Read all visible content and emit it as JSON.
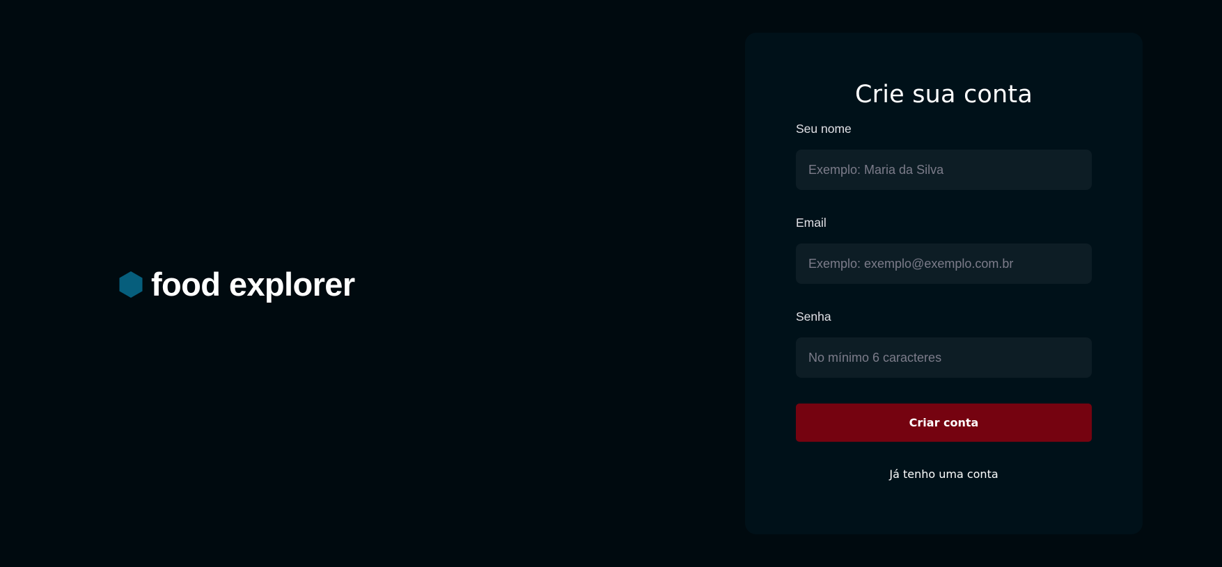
{
  "brand": {
    "name": "food explorer",
    "icon": "hexagon-icon",
    "icon_color": "#065e7c"
  },
  "form": {
    "title": "Crie sua conta",
    "fields": [
      {
        "label": "Seu nome",
        "placeholder": "Exemplo: Maria da Silva",
        "value": ""
      },
      {
        "label": "Email",
        "placeholder": "Exemplo: exemplo@exemplo.com.br",
        "value": ""
      },
      {
        "label": "Senha",
        "placeholder": "No mínimo 6 caracteres",
        "value": ""
      }
    ],
    "submit_label": "Criar conta",
    "login_link": "Já tenho uma conta"
  },
  "colors": {
    "background": "#000a0f",
    "card": "#001119",
    "input": "#0d1d25",
    "primary_button": "#750310",
    "placeholder": "#7c7c8a"
  }
}
